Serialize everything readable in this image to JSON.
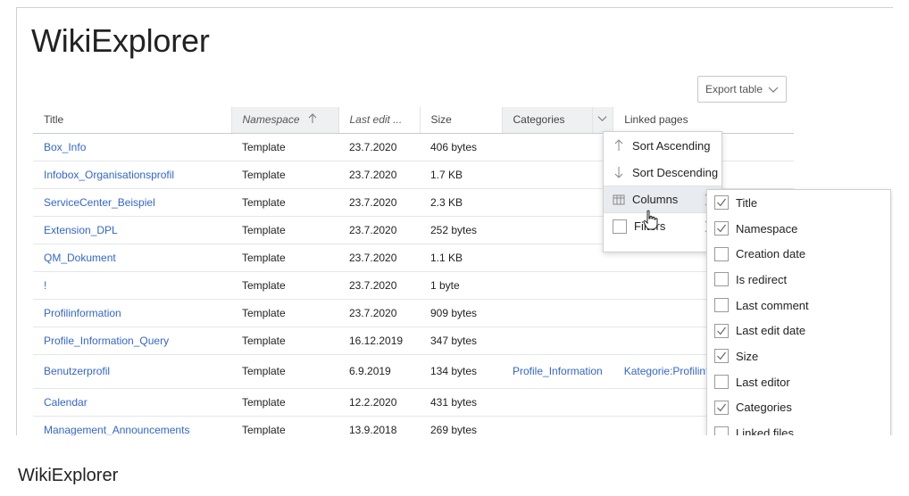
{
  "page": {
    "title": "WikiExplorer",
    "footer_title": "WikiExplorer",
    "export_button": "Export table"
  },
  "table": {
    "columns": [
      "Title",
      "Namespace",
      "Last edit ...",
      "Size",
      "Categories",
      "Linked pages"
    ],
    "rows": [
      {
        "title": "Box_Info",
        "namespace": "Template",
        "last_edit": "23.7.2020",
        "size": "406 bytes",
        "categories": "",
        "linked": ""
      },
      {
        "title": "Infobox_Organisationsprofil",
        "namespace": "Template",
        "last_edit": "23.7.2020",
        "size": "1.7 KB",
        "categories": "",
        "linked": ""
      },
      {
        "title": "ServiceCenter_Beispiel",
        "namespace": "Template",
        "last_edit": "23.7.2020",
        "size": "2.3 KB",
        "categories": "",
        "linked": ""
      },
      {
        "title": "Extension_DPL",
        "namespace": "Template",
        "last_edit": "23.7.2020",
        "size": "252 bytes",
        "categories": "",
        "linked": ""
      },
      {
        "title": "QM_Dokument",
        "namespace": "Template",
        "last_edit": "23.7.2020",
        "size": "1.1 KB",
        "categories": "",
        "linked": ""
      },
      {
        "title": "!",
        "namespace": "Template",
        "last_edit": "23.7.2020",
        "size": "1 byte",
        "categories": "",
        "linked": ""
      },
      {
        "title": "Profilinformation",
        "namespace": "Template",
        "last_edit": "23.7.2020",
        "size": "909 bytes",
        "categories": "",
        "linked": ""
      },
      {
        "title": "Profile_Information_Query",
        "namespace": "Template",
        "last_edit": "16.12.2019",
        "size": "347 bytes",
        "categories": "",
        "linked": ""
      },
      {
        "title": "Benutzerprofil",
        "namespace": "Template",
        "last_edit": "6.9.2019",
        "size": "134 bytes",
        "categories": "Profile_Information",
        "linked": "Kategorie:Profilinfo"
      },
      {
        "title": "Calendar",
        "namespace": "Template",
        "last_edit": "12.2.2020",
        "size": "431 bytes",
        "categories": "",
        "linked": ""
      },
      {
        "title": "Management_Announcements",
        "namespace": "Template",
        "last_edit": "13.9.2018",
        "size": "269 bytes",
        "categories": "",
        "linked": ""
      }
    ]
  },
  "column_menu": {
    "sort_asc": "Sort Ascending",
    "sort_desc": "Sort Descending",
    "columns": "Columns",
    "filters": "Filters"
  },
  "columns_submenu": [
    {
      "label": "Title",
      "checked": true
    },
    {
      "label": "Namespace",
      "checked": true
    },
    {
      "label": "Creation date",
      "checked": false
    },
    {
      "label": "Is redirect",
      "checked": false
    },
    {
      "label": "Last comment",
      "checked": false
    },
    {
      "label": "Last edit date",
      "checked": true
    },
    {
      "label": "Size",
      "checked": true
    },
    {
      "label": "Last editor",
      "checked": false
    },
    {
      "label": "Categories",
      "checked": true
    },
    {
      "label": "Linked files",
      "checked": false
    }
  ],
  "colors": {
    "link": "#3366cc",
    "header_active": "#eef0f2"
  }
}
